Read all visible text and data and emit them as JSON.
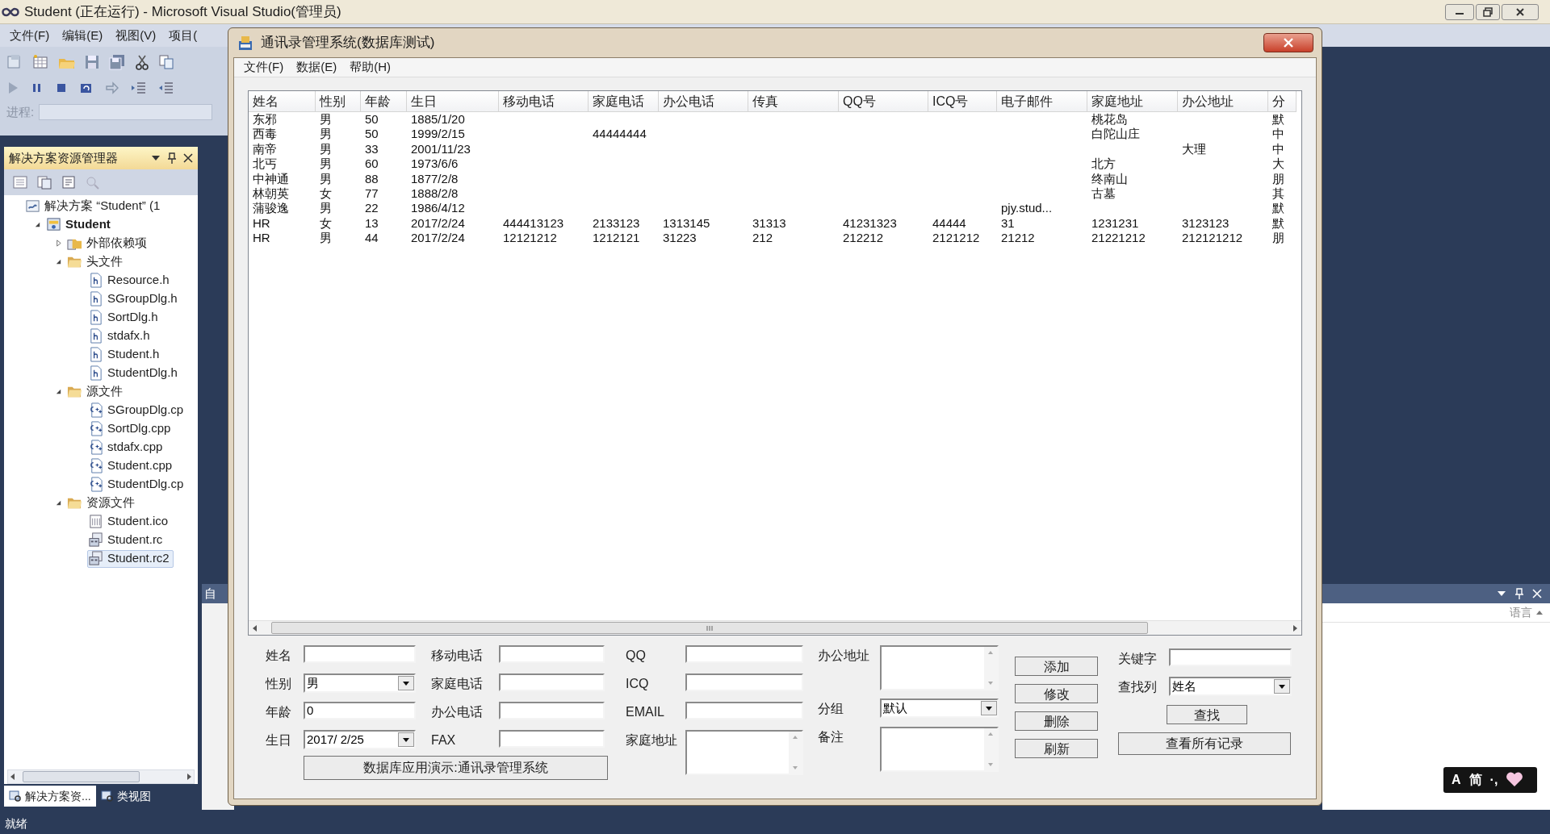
{
  "vs_window": {
    "title": "Student (正在运行) - Microsoft Visual Studio(管理员)",
    "menu": [
      "文件(F)",
      "编辑(E)",
      "视图(V)",
      "项目("
    ],
    "process_label": "进程:"
  },
  "solution_explorer": {
    "title": "解决方案资源管理器",
    "tree": [
      {
        "label": "解决方案 “Student” (1",
        "kind": "solution",
        "selected": false,
        "children": [
          {
            "label": "Student",
            "kind": "project",
            "expanded": true,
            "selected": false,
            "children": [
              {
                "label": "外部依赖项",
                "kind": "references",
                "expanded": false,
                "selected": false
              },
              {
                "label": "头文件",
                "kind": "folder",
                "expanded": true,
                "selected": false,
                "children": [
                  {
                    "label": "Resource.h",
                    "kind": "header",
                    "selected": false
                  },
                  {
                    "label": "SGroupDlg.h",
                    "kind": "header",
                    "selected": false
                  },
                  {
                    "label": "SortDlg.h",
                    "kind": "header",
                    "selected": false
                  },
                  {
                    "label": "stdafx.h",
                    "kind": "header",
                    "selected": false
                  },
                  {
                    "label": "Student.h",
                    "kind": "header",
                    "selected": false
                  },
                  {
                    "label": "StudentDlg.h",
                    "kind": "header",
                    "selected": false
                  }
                ]
              },
              {
                "label": "源文件",
                "kind": "folder",
                "expanded": true,
                "selected": false,
                "children": [
                  {
                    "label": "SGroupDlg.cp",
                    "kind": "cpp",
                    "selected": false
                  },
                  {
                    "label": "SortDlg.cpp",
                    "kind": "cpp",
                    "selected": false
                  },
                  {
                    "label": "stdafx.cpp",
                    "kind": "cpp",
                    "selected": false
                  },
                  {
                    "label": "Student.cpp",
                    "kind": "cpp",
                    "selected": false
                  },
                  {
                    "label": "StudentDlg.cp",
                    "kind": "cpp",
                    "selected": false
                  }
                ]
              },
              {
                "label": "资源文件",
                "kind": "folder",
                "expanded": true,
                "selected": false,
                "children": [
                  {
                    "label": "Student.ico",
                    "kind": "ico",
                    "selected": false
                  },
                  {
                    "label": "Student.rc",
                    "kind": "rc",
                    "selected": false
                  },
                  {
                    "label": "Student.rc2",
                    "kind": "rc",
                    "selected": true
                  }
                ]
              }
            ]
          }
        ]
      }
    ],
    "tabs": [
      {
        "label": "解决方案资...",
        "selected": true
      },
      {
        "label": "类视图",
        "selected": false
      }
    ]
  },
  "side_panel": {
    "title": "自"
  },
  "right_panel": {
    "column_label": "语言"
  },
  "dialog": {
    "title": "通讯录管理系统(数据库测试)",
    "menu": [
      "文件(F)",
      "数据(E)",
      "帮助(H)"
    ],
    "table": {
      "columns": [
        "姓名",
        "性别",
        "年龄",
        "生日",
        "移动电话",
        "家庭电话",
        "办公电话",
        "传真",
        "QQ号",
        "ICQ号",
        "电子邮件",
        "家庭地址",
        "办公地址",
        "分"
      ],
      "rows": [
        [
          "东邪",
          "男",
          "50",
          "1885/1/20",
          null,
          null,
          null,
          null,
          null,
          null,
          null,
          "桃花岛",
          null,
          "默"
        ],
        [
          "西毒",
          "男",
          "50",
          "1999/2/15",
          null,
          "44444444",
          null,
          null,
          null,
          null,
          null,
          "白陀山庄",
          null,
          "中"
        ],
        [
          "南帝",
          "男",
          "33",
          "2001/11/23",
          null,
          null,
          null,
          null,
          null,
          null,
          null,
          null,
          "大理",
          "中"
        ],
        [
          "北丐",
          "男",
          "60",
          "1973/6/6",
          null,
          null,
          null,
          null,
          null,
          null,
          null,
          "北方",
          null,
          "大"
        ],
        [
          "中神通",
          "男",
          "88",
          "1877/2/8",
          null,
          null,
          null,
          null,
          null,
          null,
          null,
          "终南山",
          null,
          "朋"
        ],
        [
          "林朝英",
          "女",
          "77",
          "1888/2/8",
          null,
          null,
          null,
          null,
          null,
          null,
          null,
          "古墓",
          null,
          "其"
        ],
        [
          "蒲骏逸",
          "男",
          "22",
          "1986/4/12",
          null,
          null,
          null,
          null,
          null,
          null,
          "pjy.stud...",
          null,
          null,
          "默"
        ],
        [
          "HR",
          "女",
          "13",
          "2017/2/24",
          "444413123",
          "2133123",
          "1313145",
          "31313",
          "41231323",
          "44444",
          "31",
          "1231231",
          "3123123",
          "默"
        ],
        [
          "HR",
          "男",
          "44",
          "2017/2/24",
          "12121212",
          "1212121",
          "31223",
          "212",
          "212212",
          "2121212",
          "21212",
          "21221212",
          "212121212",
          "朋"
        ]
      ]
    },
    "form_columns": [
      [
        {
          "label": "姓名",
          "kind": "text"
        },
        {
          "label": "性别",
          "kind": "combo",
          "value": "男"
        },
        {
          "label": "年龄",
          "kind": "text",
          "value": "0"
        },
        {
          "label": "生日",
          "kind": "date",
          "value": "2017/ 2/25"
        }
      ],
      [
        {
          "label": "移动电话",
          "kind": "text"
        },
        {
          "label": "家庭电话",
          "kind": "text"
        },
        {
          "label": "办公电话",
          "kind": "text"
        },
        {
          "label": "FAX",
          "kind": "text"
        }
      ],
      [
        {
          "label": "QQ",
          "kind": "text"
        },
        {
          "label": "ICQ",
          "kind": "text"
        },
        {
          "label": "EMAIL",
          "kind": "text"
        },
        {
          "label": "家庭地址",
          "kind": "memo"
        }
      ],
      [
        {
          "label": "办公地址",
          "kind": "memo"
        },
        {
          "label": "分组",
          "kind": "combo",
          "value": "默认"
        },
        {
          "label": "备注",
          "kind": "memo"
        }
      ]
    ],
    "banner_button": "数据库应用演示:通讯录管理系统",
    "action_buttons": [
      "添加",
      "修改",
      "删除",
      "刷新"
    ],
    "search": {
      "fields": [
        {
          "label": "关键字",
          "kind": "text"
        },
        {
          "label": "查找列",
          "kind": "combo",
          "value": "姓名"
        }
      ],
      "find_button": "查找",
      "show_all_button": "查看所有记录"
    }
  },
  "ime": {
    "mode": "A",
    "language": "简",
    "punctuation": "·,"
  },
  "status_bar": "就绪"
}
